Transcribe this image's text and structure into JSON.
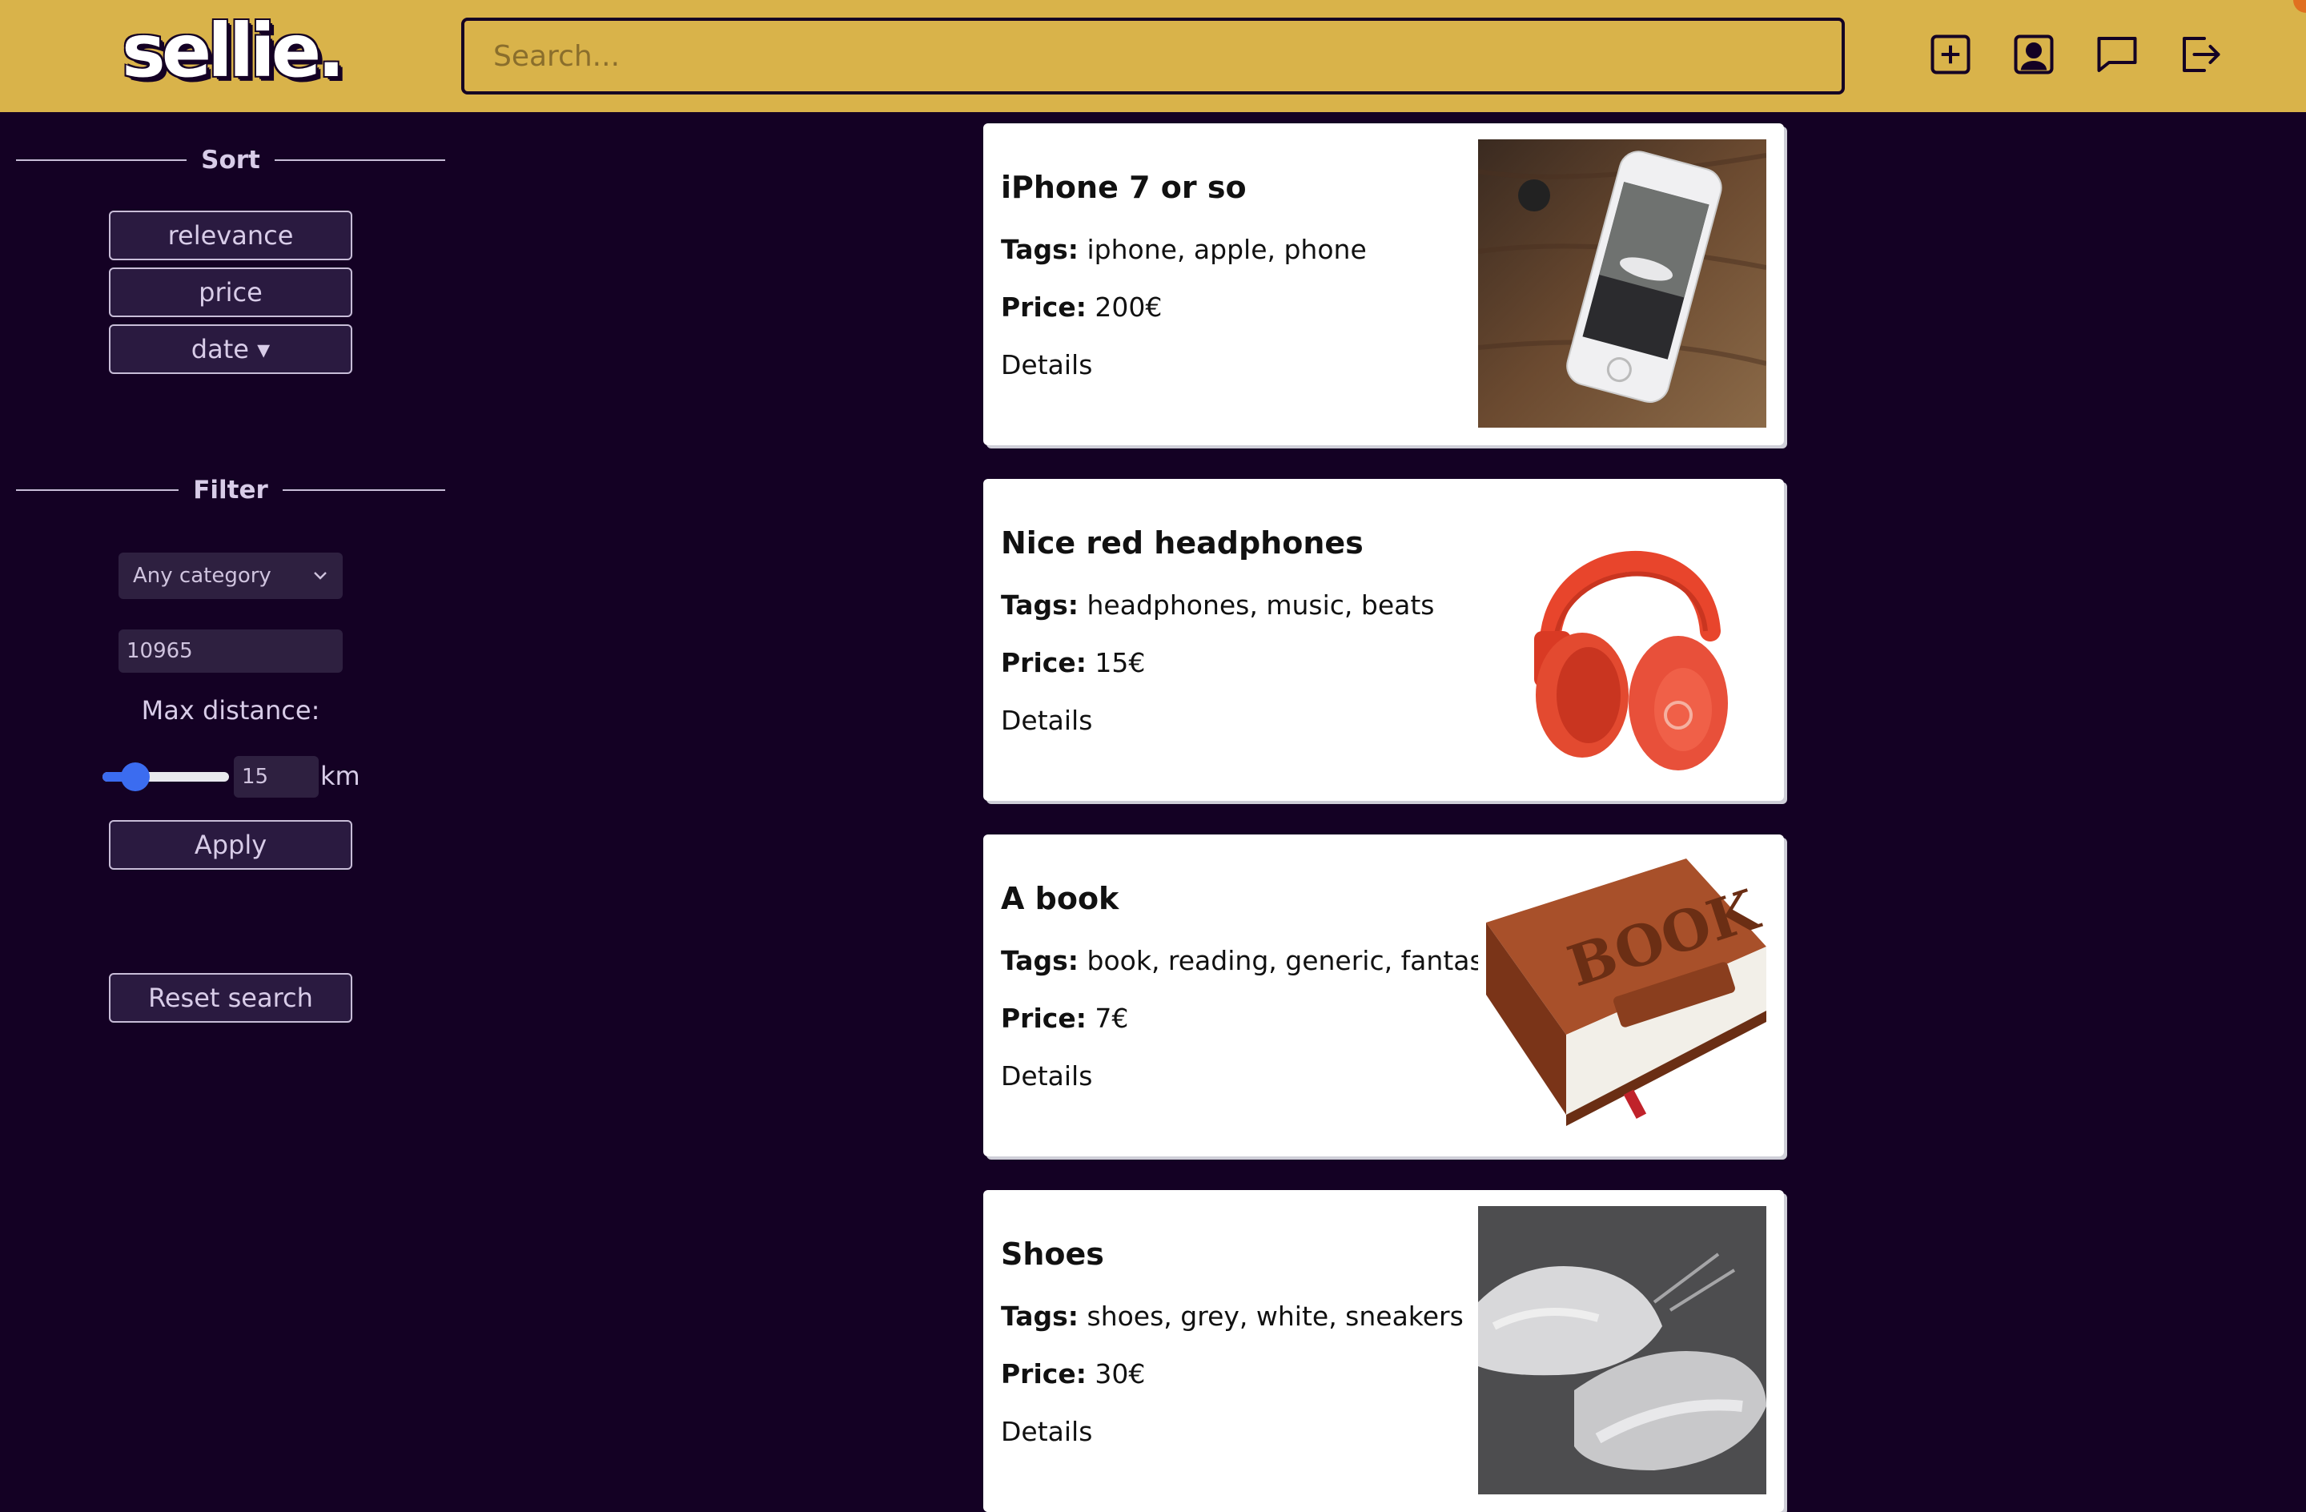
{
  "header": {
    "logo": "sellie.",
    "search_placeholder": "Search...",
    "icons": [
      "plus-square-icon",
      "user-icon",
      "chat-icon",
      "logout-icon"
    ]
  },
  "sidebar": {
    "sort": {
      "title": "Sort",
      "options": [
        "relevance",
        "price",
        "date ▾"
      ]
    },
    "filter": {
      "title": "Filter",
      "category_selected": "Any category",
      "zip_value": "10965",
      "max_distance_label": "Max distance:",
      "distance_value": "15",
      "distance_unit": "km",
      "slider_fraction": 0.26,
      "apply_label": "Apply",
      "reset_label": "Reset search"
    }
  },
  "listings": [
    {
      "title": "iPhone 7 or so",
      "tags_label": "Tags:",
      "tags": "iphone, apple, phone",
      "price_label": "Price:",
      "price": "200€",
      "details": "Details",
      "image": "phone-photo"
    },
    {
      "title": "Nice red headphones",
      "tags_label": "Tags:",
      "tags": "headphones, music, beats",
      "price_label": "Price:",
      "price": "15€",
      "details": "Details",
      "image": "headphones-photo"
    },
    {
      "title": "A book",
      "tags_label": "Tags:",
      "tags": "book, reading, generic, fantasy",
      "price_label": "Price:",
      "price": "7€",
      "details": "Details",
      "image": "book-photo",
      "image_text": "BOOK"
    },
    {
      "title": "Shoes",
      "tags_label": "Tags:",
      "tags": "shoes, grey, white, sneakers",
      "price_label": "Price:",
      "price": "30€",
      "details": "Details",
      "image": "shoes-photo"
    }
  ],
  "colors": {
    "header_bg": "#d9b34a",
    "page_bg": "#140124",
    "accent_blue": "#3b6cf0"
  }
}
